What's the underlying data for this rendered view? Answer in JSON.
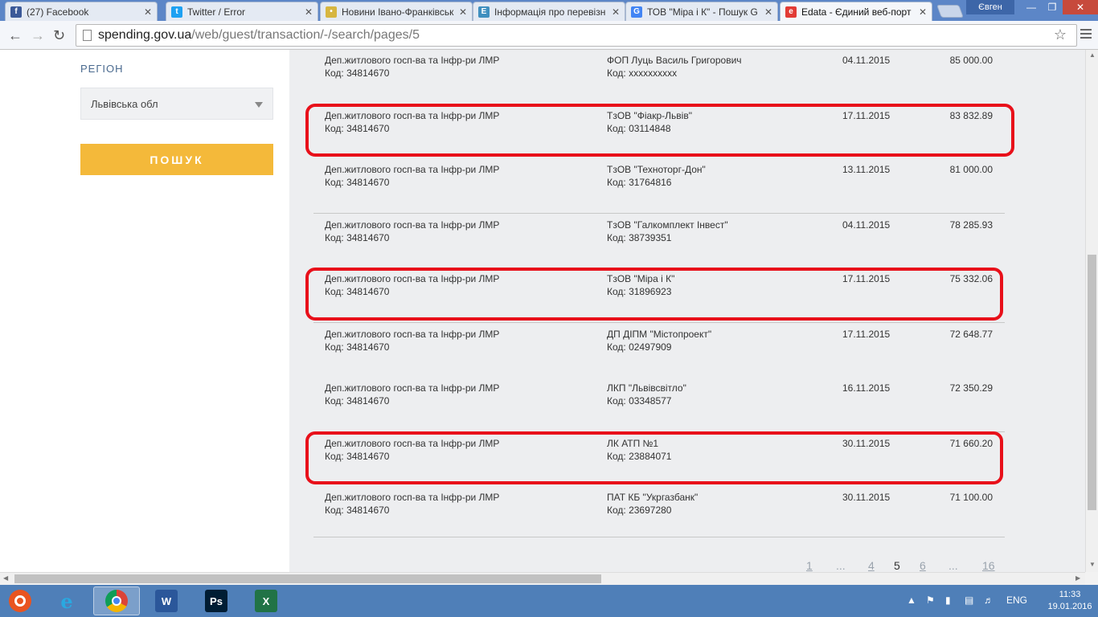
{
  "browser": {
    "tabs": [
      {
        "label": "(27) Facebook",
        "icon": "facebook-icon",
        "color": "#3b5998",
        "glyph": "f"
      },
      {
        "label": "Twitter / Error",
        "icon": "twitter-icon",
        "color": "#1da1f2",
        "glyph": "t"
      },
      {
        "label": "Новини Івано-Франківськ",
        "icon": "news-icon",
        "color": "#d7b640",
        "glyph": "•"
      },
      {
        "label": "Інформація про перевізн",
        "icon": "info-icon",
        "color": "#3f8fbf",
        "glyph": "E"
      },
      {
        "label": "ТОВ \"Міра і К\" - Пошук G",
        "icon": "google-icon",
        "color": "#4285f4",
        "glyph": "G"
      },
      {
        "label": "Edata - Єдиний веб-порт",
        "icon": "edata-icon",
        "color": "#e23b35",
        "glyph": "e"
      }
    ],
    "profile": "Євген",
    "url_host": "spending.gov.ua",
    "url_path": "/web/guest/transaction/-/search/pages/5"
  },
  "sidebar": {
    "region_label": "РЕГІОН",
    "region_value": "Львівська обл",
    "search_button": "ПОШУК"
  },
  "transactions": [
    {
      "payer": "Деп.житлового госп-ва та Інфр-ри ЛМР",
      "payer_code": "Код: 34814670",
      "receiver": "ФОП Луць Василь Григорович",
      "receiver_code": "Код: xxxxxxxxxx",
      "date": "04.11.2015",
      "amount": "85 000.00",
      "highlighted": false
    },
    {
      "payer": "Деп.житлового госп-ва та Інфр-ри ЛМР",
      "payer_code": "Код: 34814670",
      "receiver": "ТзОВ \"Фіакр-Львів\"",
      "receiver_code": "Код: 03114848",
      "date": "17.11.2015",
      "amount": "83 832.89",
      "highlighted": true
    },
    {
      "payer": "Деп.житлового госп-ва та Інфр-ри ЛМР",
      "payer_code": "Код: 34814670",
      "receiver": "ТзОВ \"Техноторг-Дон\"",
      "receiver_code": "Код: 31764816",
      "date": "13.11.2015",
      "amount": "81 000.00",
      "highlighted": false
    },
    {
      "payer": "Деп.житлового госп-ва та Інфр-ри ЛМР",
      "payer_code": "Код: 34814670",
      "receiver": "ТзОВ \"Галкомплект Інвест\"",
      "receiver_code": "Код: 38739351",
      "date": "04.11.2015",
      "amount": "78 285.93",
      "highlighted": false
    },
    {
      "payer": "Деп.житлового госп-ва та Інфр-ри ЛМР",
      "payer_code": "Код: 34814670",
      "receiver": "ТзОВ \"Міра і К\"",
      "receiver_code": "Код: 31896923",
      "date": "17.11.2015",
      "amount": "75 332.06",
      "highlighted": true
    },
    {
      "payer": "Деп.житлового госп-ва та Інфр-ри ЛМР",
      "payer_code": "Код: 34814670",
      "receiver": "ДП ДІПМ \"Містопроект\"",
      "receiver_code": "Код: 02497909",
      "date": "17.11.2015",
      "amount": "72 648.77",
      "highlighted": false
    },
    {
      "payer": "Деп.житлового госп-ва та Інфр-ри ЛМР",
      "payer_code": "Код: 34814670",
      "receiver": "ЛКП \"Львівсвітло\"",
      "receiver_code": "Код: 03348577",
      "date": "16.11.2015",
      "amount": "72 350.29",
      "highlighted": false
    },
    {
      "payer": "Деп.житлового госп-ва та Інфр-ри ЛМР",
      "payer_code": "Код: 34814670",
      "receiver": "ЛК АТП №1",
      "receiver_code": "Код: 23884071",
      "date": "30.11.2015",
      "amount": "71 660.20",
      "highlighted": true
    },
    {
      "payer": "Деп.житлового госп-ва та Інфр-ри ЛМР",
      "payer_code": "Код: 34814670",
      "receiver": "ПАТ КБ \"Укргазбанк\"",
      "receiver_code": "Код: 23697280",
      "date": "30.11.2015",
      "amount": "71 100.00",
      "highlighted": false
    }
  ],
  "pagination": [
    {
      "label": "1",
      "kind": "link"
    },
    {
      "label": "...",
      "kind": "dots"
    },
    {
      "label": "4",
      "kind": "link"
    },
    {
      "label": "5",
      "kind": "current"
    },
    {
      "label": "6",
      "kind": "link"
    },
    {
      "label": "...",
      "kind": "dots"
    },
    {
      "label": "16",
      "kind": "link"
    }
  ],
  "taskbar": {
    "apps": [
      {
        "name": "ubuntu-icon",
        "color": "#e95420"
      },
      {
        "name": "internet-explorer-icon",
        "color": "#2aa8e0"
      },
      {
        "name": "chrome-icon",
        "color": "#db4437",
        "active": true
      },
      {
        "name": "word-icon",
        "color": "#2b579a",
        "glyph": "W"
      },
      {
        "name": "photoshop-icon",
        "color": "#001d34",
        "glyph": "Ps"
      },
      {
        "name": "excel-icon",
        "color": "#217346",
        "glyph": "X"
      }
    ],
    "lang": "ENG",
    "time": "11:33",
    "date": "19.01.2016"
  }
}
